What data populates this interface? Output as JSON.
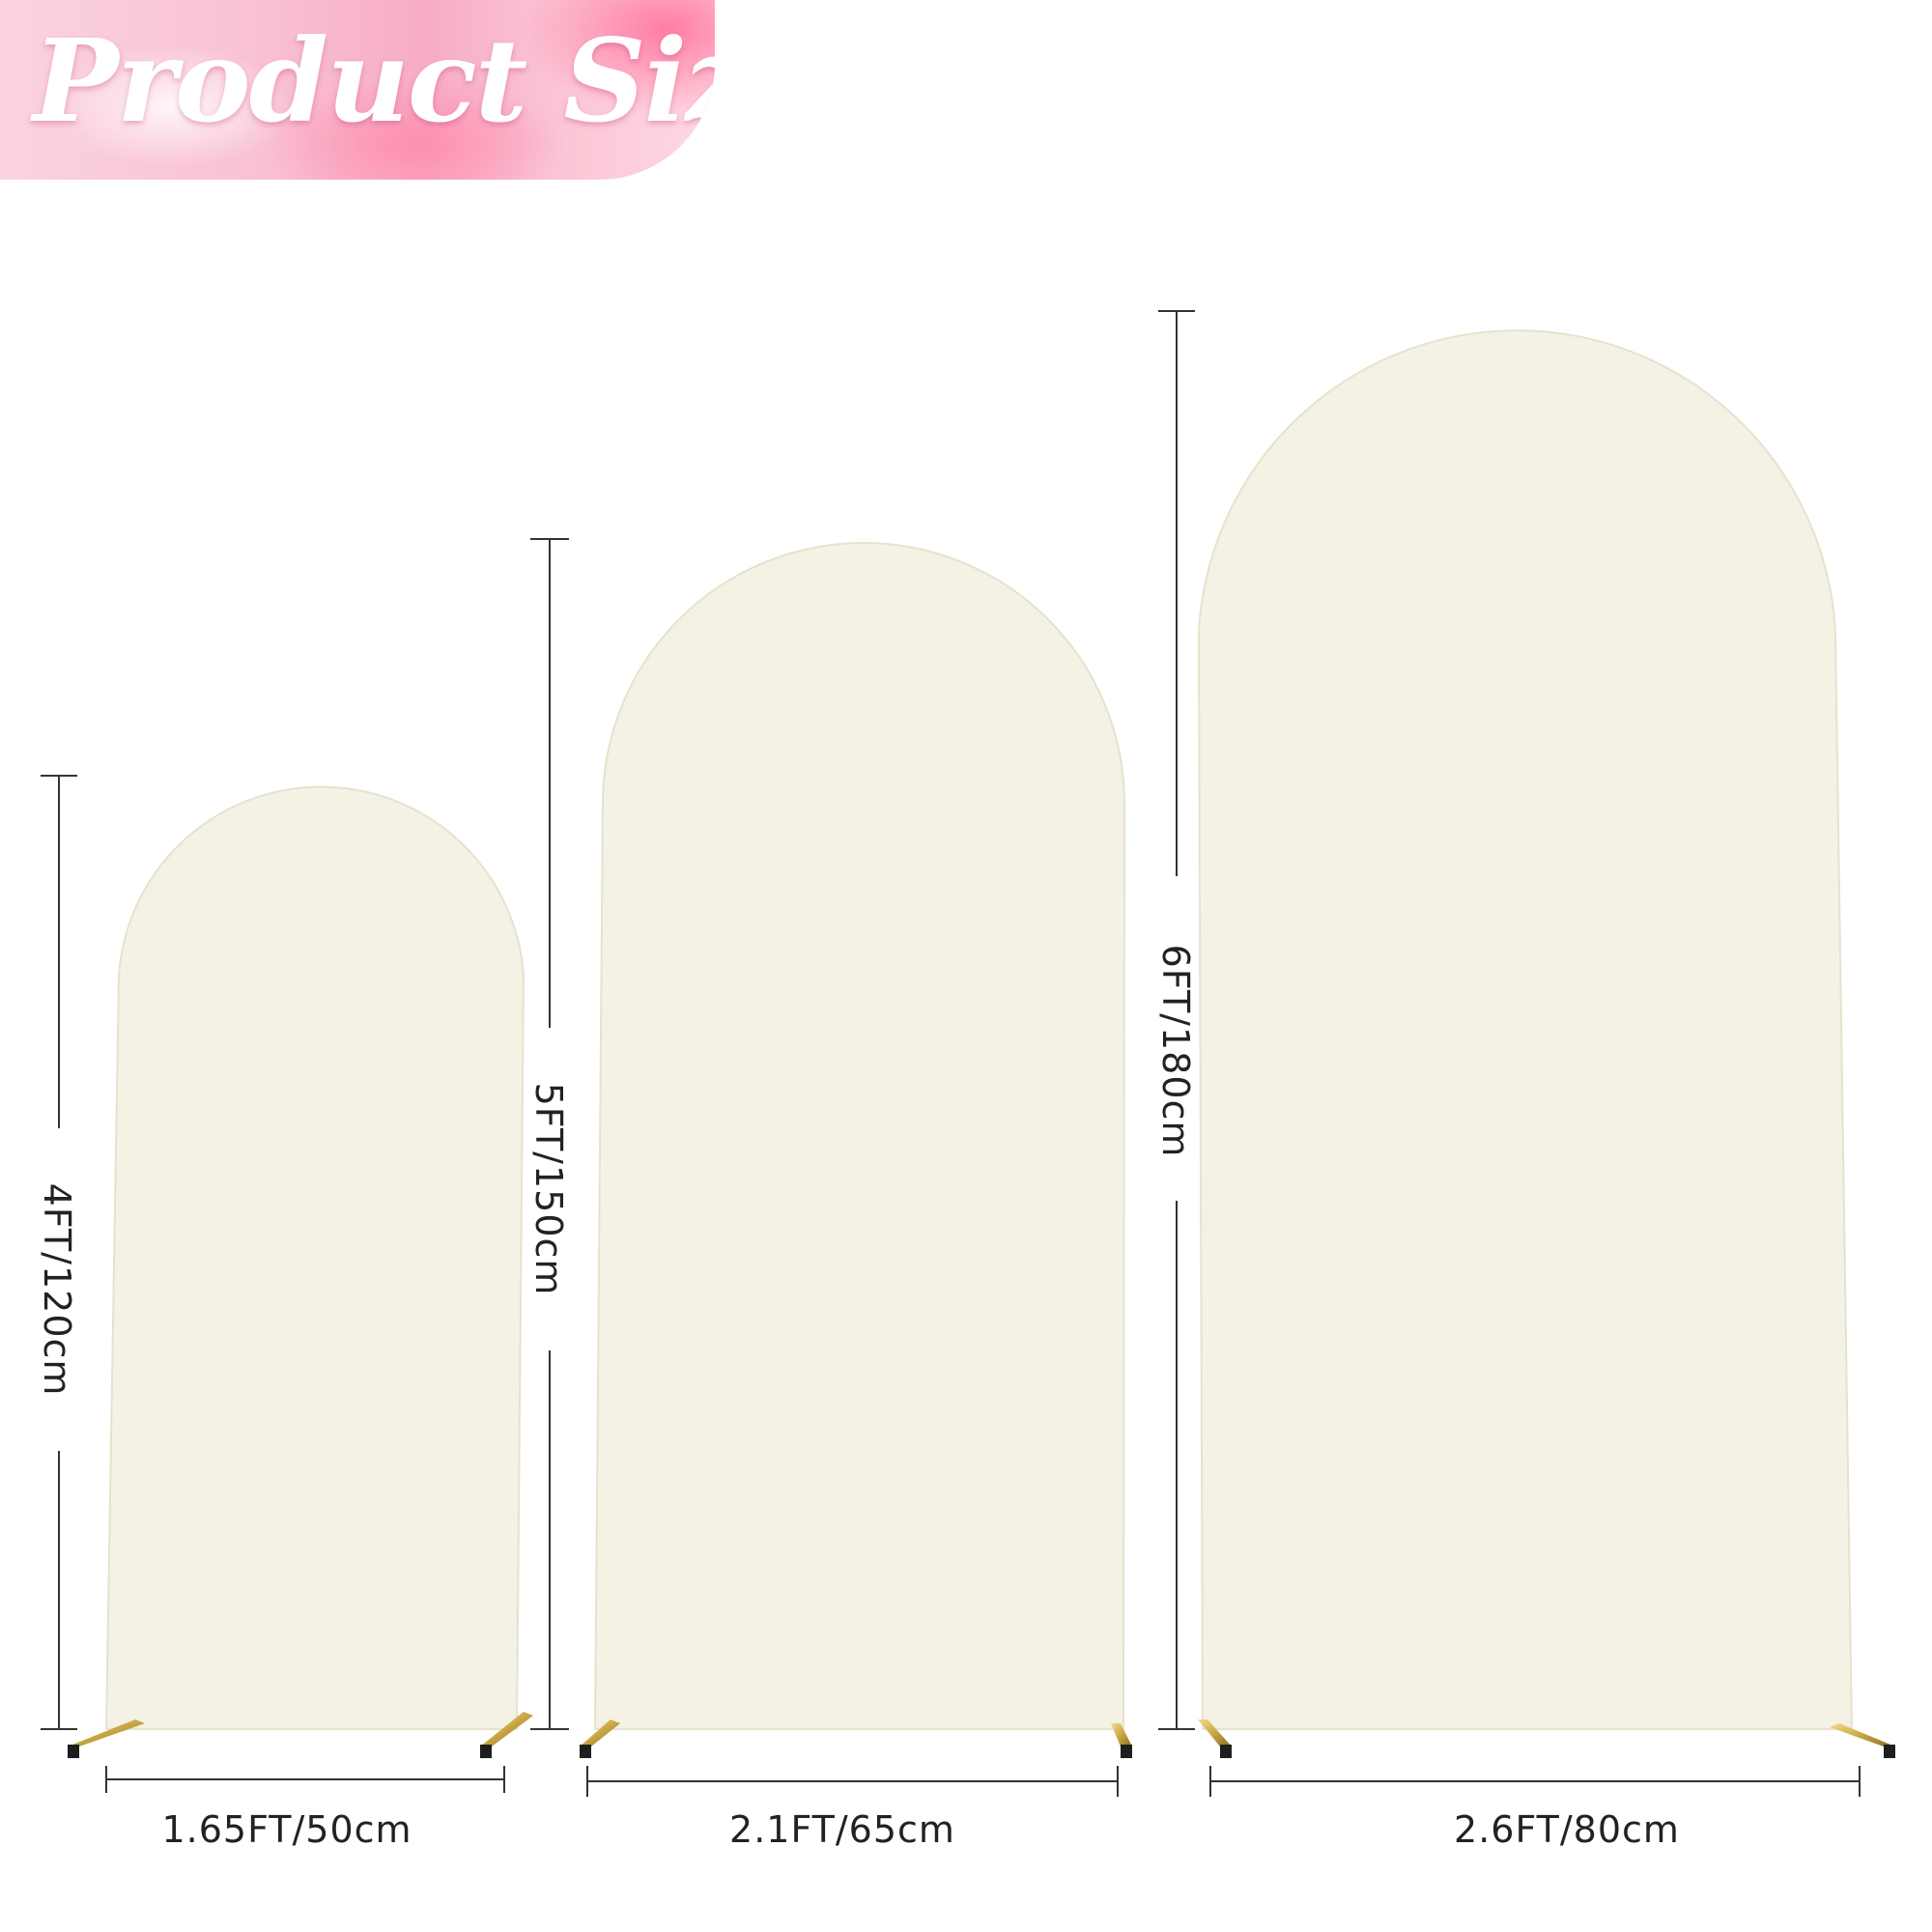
{
  "banner": {
    "title": "Product Size"
  },
  "colors": {
    "panel_fill": "#f4f1e5",
    "panel_edge": "#e7e2cf",
    "stand_gold": "#c9a643",
    "dimension_line": "#333333",
    "banner_pink": "#f7adc4"
  },
  "arches": [
    {
      "name": "small",
      "height_label": "4FT/120cm",
      "width_label": "1.65FT/50cm"
    },
    {
      "name": "medium",
      "height_label": "5FT/150cm",
      "width_label": "2.1FT/65cm"
    },
    {
      "name": "large",
      "height_label": "6FT/180cm",
      "width_label": "2.6FT/80cm"
    }
  ]
}
